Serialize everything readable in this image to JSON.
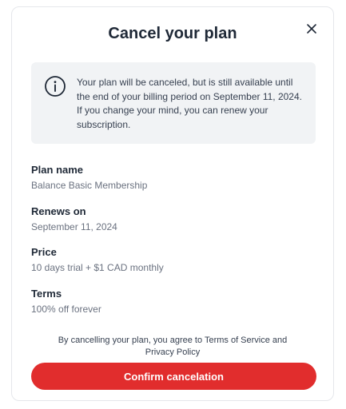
{
  "modal": {
    "title": "Cancel your plan",
    "close_icon": "close-icon"
  },
  "notice": {
    "icon": "info-icon",
    "text": "Your plan will be canceled, but is still available until the end of your billing period on September 11, 2024. If you change your mind, you can renew your subscription."
  },
  "details": [
    {
      "label": "Plan name",
      "value": "Balance Basic Membership"
    },
    {
      "label": "Renews on",
      "value": "September 11, 2024"
    },
    {
      "label": "Price",
      "value": "10 days trial + $1 CAD monthly"
    },
    {
      "label": "Terms",
      "value": "100% off forever"
    }
  ],
  "agreement": "By cancelling your plan, you agree to Terms of Service and Privacy Policy",
  "confirm_label": "Confirm cancelation",
  "colors": {
    "confirm_button": "#e12d2d",
    "notice_background": "#f1f3f5"
  }
}
